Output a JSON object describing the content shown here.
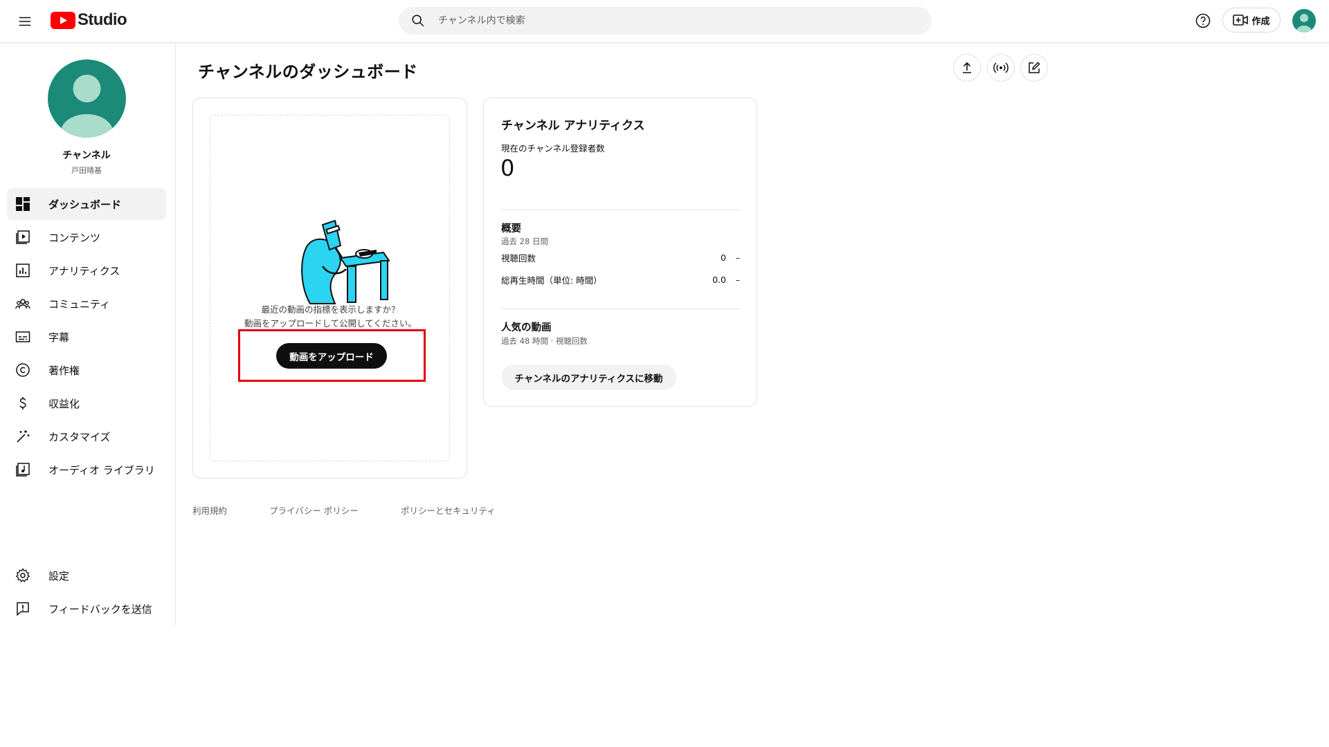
{
  "header": {
    "app_name": "Studio",
    "search_placeholder": "チャンネル内で検索",
    "create_label": "作成"
  },
  "sidebar": {
    "channel_name": "チャンネル",
    "channel_owner": "戸田晴基",
    "items": [
      {
        "label": "ダッシュボード",
        "icon": "dashboard-icon",
        "active": true
      },
      {
        "label": "コンテンツ",
        "icon": "content-icon"
      },
      {
        "label": "アナリティクス",
        "icon": "analytics-icon"
      },
      {
        "label": "コミュニティ",
        "icon": "community-icon"
      },
      {
        "label": "字幕",
        "icon": "subtitles-icon"
      },
      {
        "label": "著作権",
        "icon": "copyright-icon"
      },
      {
        "label": "収益化",
        "icon": "monetization-icon"
      },
      {
        "label": "カスタマイズ",
        "icon": "customization-icon"
      },
      {
        "label": "オーディオ ライブラリ",
        "icon": "audio-library-icon"
      }
    ],
    "bottom_items": [
      {
        "label": "設定",
        "icon": "settings-icon"
      },
      {
        "label": "フィードバックを送信",
        "icon": "feedback-icon"
      }
    ]
  },
  "main": {
    "title": "チャンネルのダッシュボード",
    "upload_card": {
      "prompt_line1": "最近の動画の指標を表示しますか？",
      "prompt_line2": "動画をアップロードして公開してください。",
      "button": "動画をアップロード"
    },
    "analytics_card": {
      "title": "チャンネル アナリティクス",
      "subscribers_label": "現在のチャンネル登録者数",
      "subscribers_value": "0",
      "summary_title": "概要",
      "summary_period": "過去 28 日間",
      "metrics": [
        {
          "label": "視聴回数",
          "value": "0",
          "trend": "–"
        },
        {
          "label": "総再生時間（単位: 時間）",
          "value": "0.0",
          "trend": "–"
        }
      ],
      "top_videos_title": "人気の動画",
      "top_videos_period": "過去 48 時間 · 視聴回数",
      "button": "チャンネルのアナリティクスに移動"
    },
    "footer_links": [
      "利用規約",
      "プライバシー ポリシー",
      "ポリシーとセキュリティ"
    ]
  },
  "colors": {
    "youtube_red": "#ff0000",
    "avatar_bg": "#1b8a78",
    "avatar_fg": "#a9dccb",
    "highlight": "#e0000a",
    "illustration": "#2bd4f0"
  }
}
